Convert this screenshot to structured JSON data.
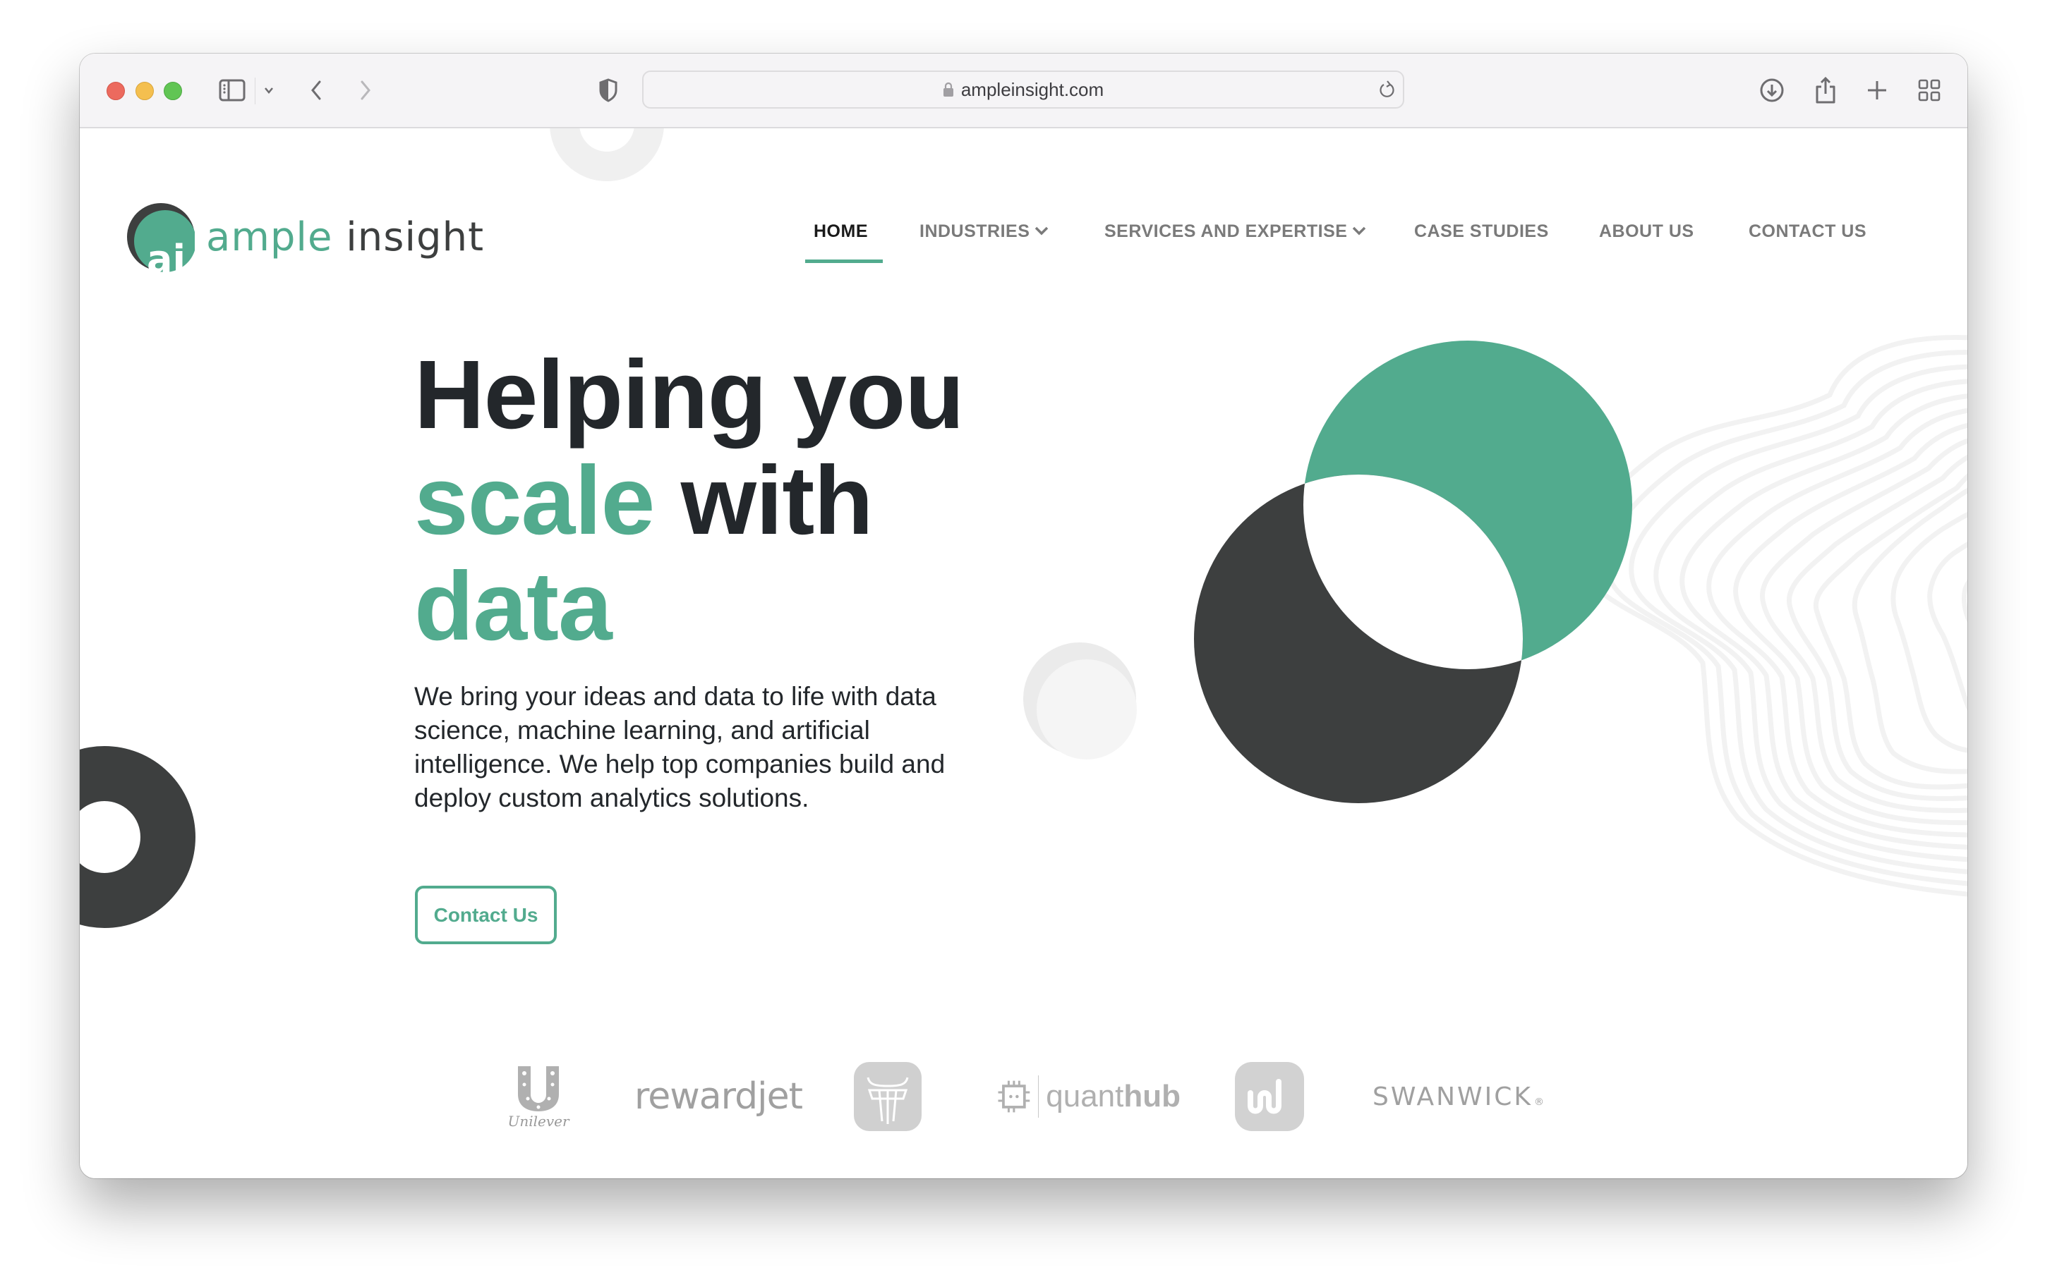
{
  "browser": {
    "url": "ampleinsight.com",
    "icons": {
      "close": "close-window-icon",
      "minimize": "minimize-window-icon",
      "zoom": "zoom-window-icon",
      "sidebar": "sidebar-toggle-icon",
      "back": "back-icon",
      "forward": "forward-icon",
      "privacy": "shield-icon",
      "lock": "lock-icon",
      "reload": "reload-icon",
      "download": "download-icon",
      "share": "share-icon",
      "new_tab": "plus-icon",
      "tab_overview": "grid-icon"
    }
  },
  "site": {
    "logo": {
      "mark": "ai",
      "word1": "ample",
      "word2": "insight"
    },
    "nav": [
      {
        "label": "HOME",
        "active": true
      },
      {
        "label": "INDUSTRIES",
        "dropdown": true
      },
      {
        "label": "SERVICES AND EXPERTISE",
        "dropdown": true
      },
      {
        "label": "CASE STUDIES"
      },
      {
        "label": "ABOUT US"
      },
      {
        "label": "CONTACT US"
      }
    ],
    "hero": {
      "line1": "Helping you",
      "line2_accent": "scale",
      "line2_rest": " with",
      "line3_accent": "data",
      "description": "We bring your ideas and data to life with data science, machine learning, and artificial intelligence. We help top companies build and deploy custom analytics solutions.",
      "cta_label": "Contact Us"
    },
    "clients": [
      {
        "name": "Unilever",
        "label": "Unilever"
      },
      {
        "name": "rewardjet",
        "label": "rewardjet"
      },
      {
        "name": "bull-logo",
        "label": ""
      },
      {
        "name": "quanthub",
        "label_light": "quant",
        "label_bold": "hub"
      },
      {
        "name": "w-logo",
        "label": ""
      },
      {
        "name": "swanwick",
        "label": "SWANWICK",
        "mark": "®"
      }
    ],
    "colors": {
      "accent": "#52ab8e",
      "dark": "#3d3f3f",
      "text": "#23272b",
      "nav_inactive": "#7a7a7a",
      "logo_gray": "#a6a6a6",
      "deco_light": "#f0f0f0"
    }
  }
}
